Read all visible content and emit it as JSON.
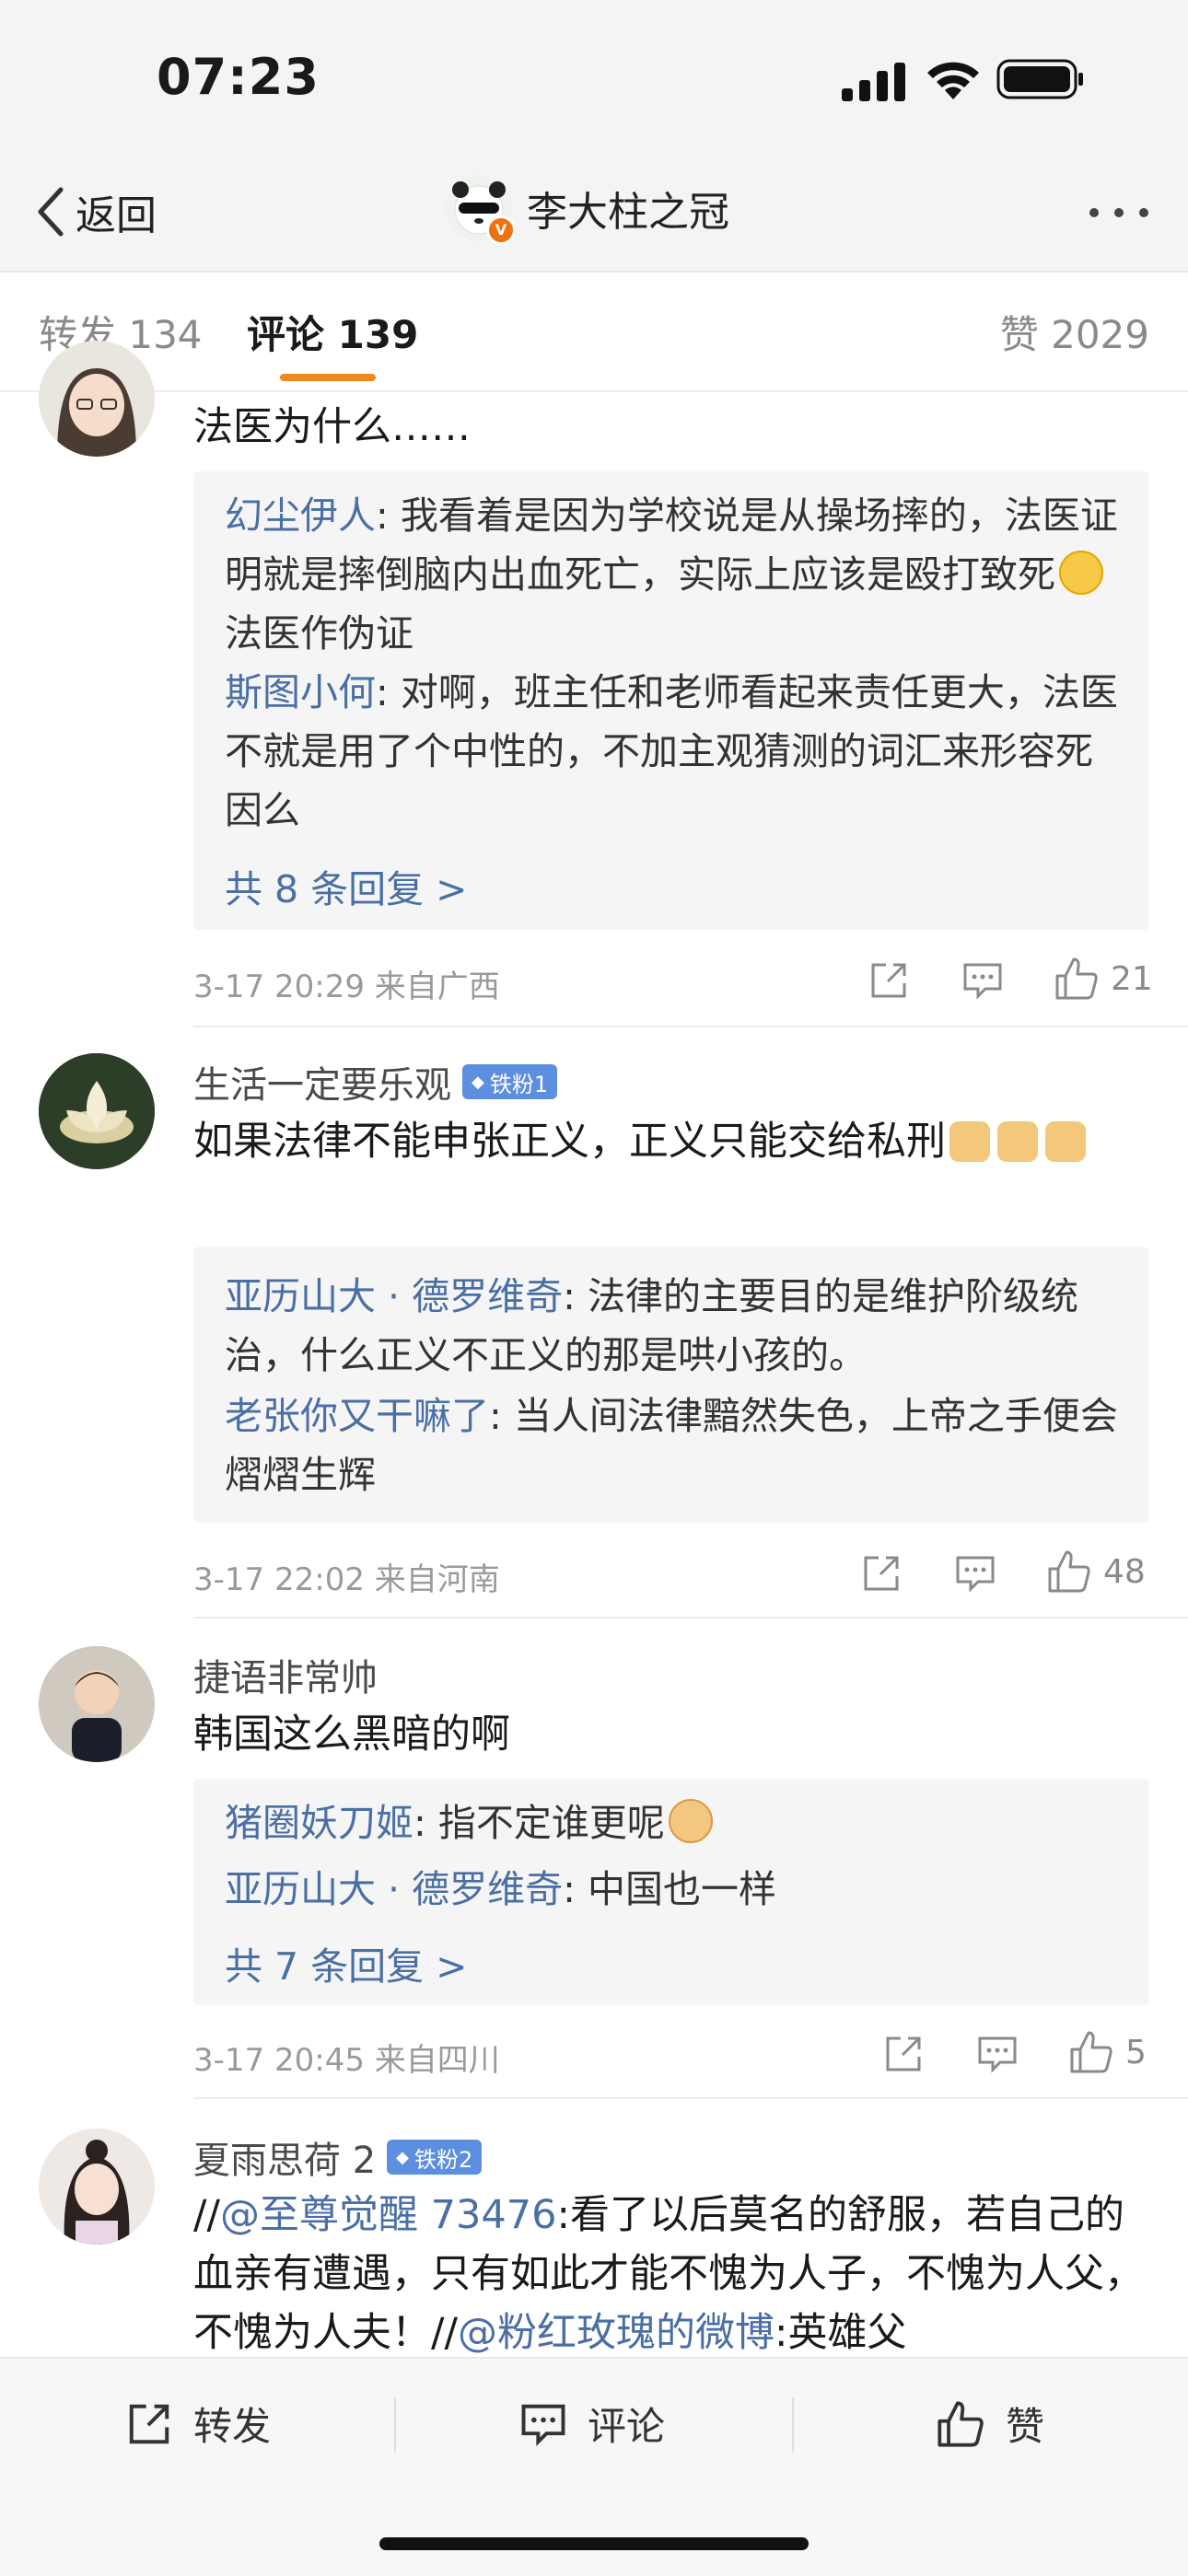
{
  "status_bar": {
    "time": "07:23"
  },
  "nav": {
    "back_label": "返回",
    "title": "李大柱之冠",
    "verified_badge": "V"
  },
  "tabs": {
    "repost": "转发 134",
    "comment": "评论 139",
    "like": "赞 2029"
  },
  "comments": [
    {
      "text": "法医为什么……",
      "replies": [
        {
          "name": "幻尘伊人",
          "text": ": 我看着是因为学校说是从操场摔的，法医证明就是摔倒脑内出血死亡，实际上应该是殴打致死",
          "text2": "法医作伪证",
          "emoji": "crying-emoji"
        },
        {
          "name": "斯图小何",
          "text": ": 对啊，班主任和老师看起来责任更大，法医不就是用了个中性的，不加主观猜测的词汇来形容死因么"
        }
      ],
      "more_replies": "共 8 条回复 >",
      "time_location": "3-17 20:29  来自广西",
      "likes": "21"
    },
    {
      "username": "生活一定要乐观",
      "fan_badge": "铁粉1",
      "text": "如果法律不能申张正义，正义只能交给私刑",
      "emoji": "thumbs-up-emoji",
      "replies": [
        {
          "name": "亚历山大 · 德罗维奇",
          "text": ": 法律的主要目的是维护阶级统治，什么正义不正义的那是哄小孩的。"
        },
        {
          "name": "老张你又干嘛了",
          "text": ": 当人间法律黯然失色，上帝之手便会熠熠生辉"
        }
      ],
      "time_location": "3-17 22:02  来自河南",
      "likes": "48"
    },
    {
      "username": "捷语非常帅",
      "text": "韩国这么黑暗的啊",
      "replies": [
        {
          "name": "猪圈妖刀姬",
          "text": ": 指不定谁更呢",
          "emoji": "doge-emoji"
        },
        {
          "name": "亚历山大 · 德罗维奇",
          "text": ": 中国也一样"
        }
      ],
      "more_replies": "共 7 条回复 >",
      "time_location": "3-17 20:45  来自四川",
      "likes": "5"
    },
    {
      "username": "夏雨思荷 2",
      "fan_badge": "铁粉2",
      "prefix": "//",
      "mention1": "@至尊觉醒 73476",
      "middle": ":看了以后莫名的舒服，若自己的血亲有遭遇，只有如此才能不愧为人子，不愧为人父，不愧为人夫！//",
      "mention2": "@粉红玫瑰的微博",
      "suffix": ":英雄父"
    }
  ],
  "bottom_bar": {
    "repost": "转发",
    "comment": "评论",
    "like": "赞"
  },
  "colors": {
    "accent": "#f08a1e",
    "link": "#4a6fa5",
    "fan_badge": "#5d8fe0"
  }
}
